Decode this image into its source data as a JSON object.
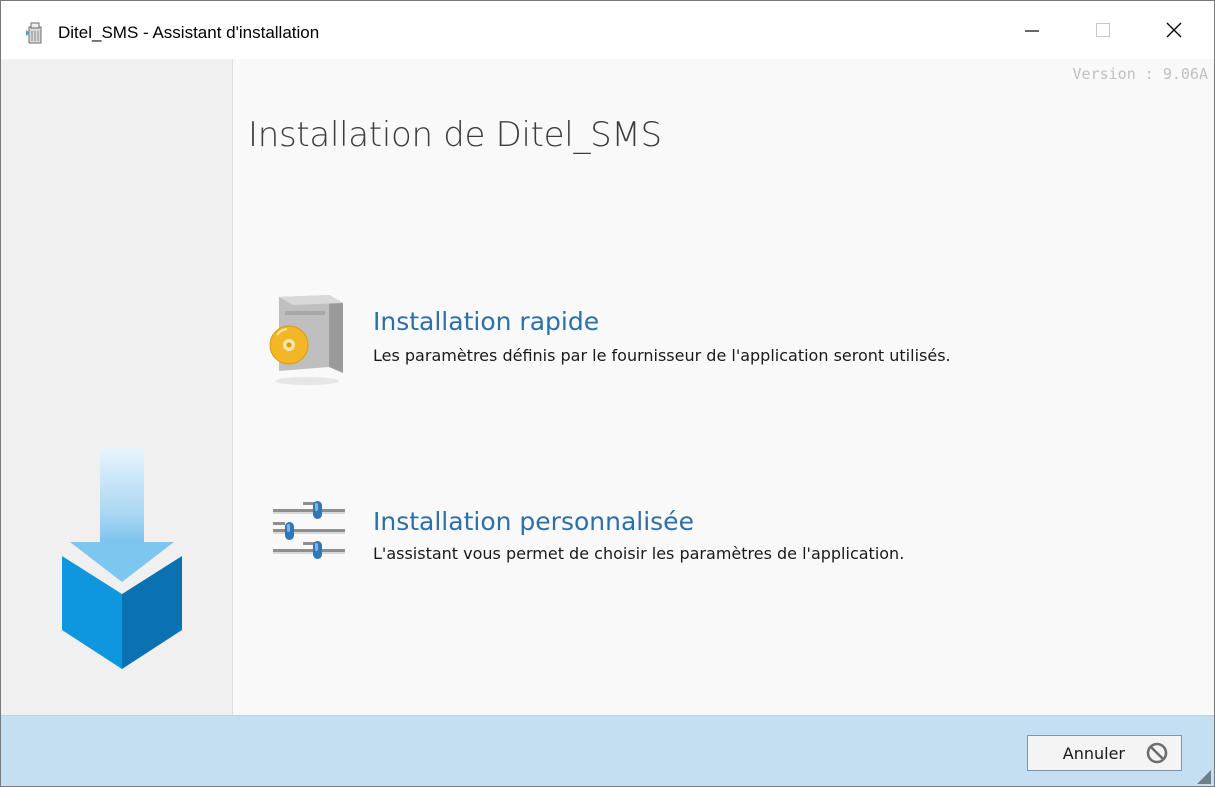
{
  "window": {
    "title": "Ditel_SMS - Assistant d'installation",
    "controls": {
      "minimize": "minimize",
      "maximize": "maximize",
      "close": "close"
    }
  },
  "content": {
    "version": "Version : 9.06A",
    "title": "Installation de Ditel_SMS",
    "options": [
      {
        "title": "Installation rapide",
        "description": "Les paramètres définis par le fournisseur de l'application seront utilisés.",
        "icon": "package-disc-icon"
      },
      {
        "title": "Installation personnalisée",
        "description": "L'assistant vous permet de choisir les paramètres de l'application.",
        "icon": "sliders-icon"
      }
    ]
  },
  "footer": {
    "cancel_label": "Annuler",
    "cancel_icon": "cancel-icon"
  },
  "colors": {
    "accent_blue": "#2f6fa8",
    "footer_bg": "#c5dff2",
    "box_blue": "#0f8fd6"
  }
}
